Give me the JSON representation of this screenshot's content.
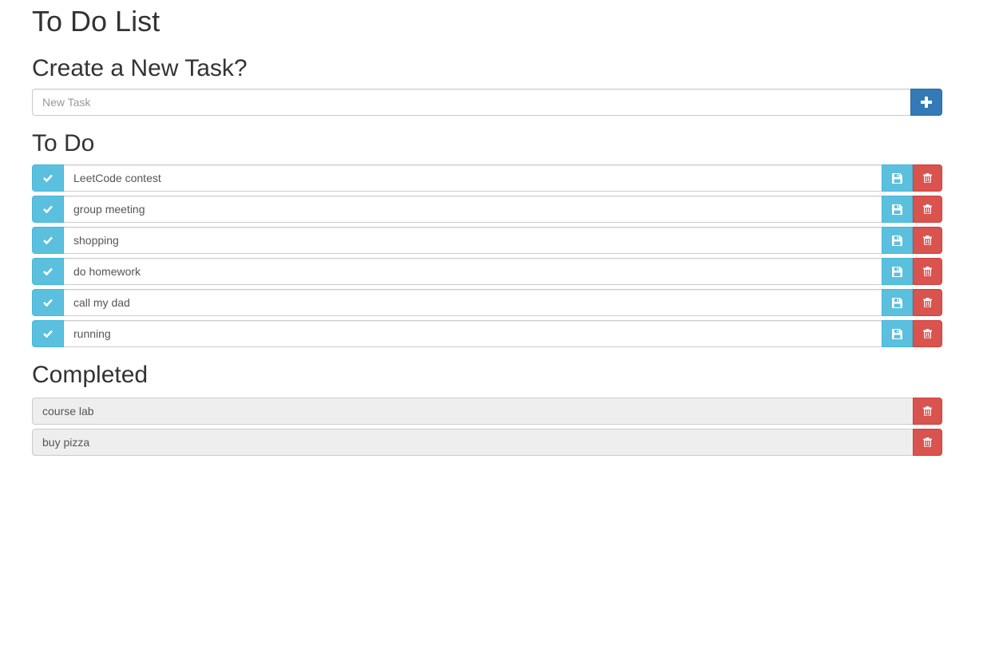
{
  "app": {
    "title": "To Do List"
  },
  "create": {
    "heading": "Create a New Task?",
    "input_placeholder": "New Task",
    "input_value": "",
    "add_icon": "plus-icon"
  },
  "todo": {
    "heading": "To Do",
    "items": [
      {
        "label": "LeetCode contest"
      },
      {
        "label": "group meeting"
      },
      {
        "label": "shopping"
      },
      {
        "label": "do homework"
      },
      {
        "label": "call my dad"
      },
      {
        "label": "running"
      }
    ],
    "icons": {
      "complete": "check-icon",
      "save": "floppy-disk-icon",
      "delete": "trash-icon"
    }
  },
  "completed": {
    "heading": "Completed",
    "items": [
      {
        "label": "course lab"
      },
      {
        "label": "buy pizza"
      }
    ],
    "icons": {
      "delete": "trash-icon"
    }
  },
  "colors": {
    "primary": "#337ab7",
    "info": "#5bc0de",
    "danger": "#d9534f",
    "completed_bg": "#eeeeee"
  }
}
